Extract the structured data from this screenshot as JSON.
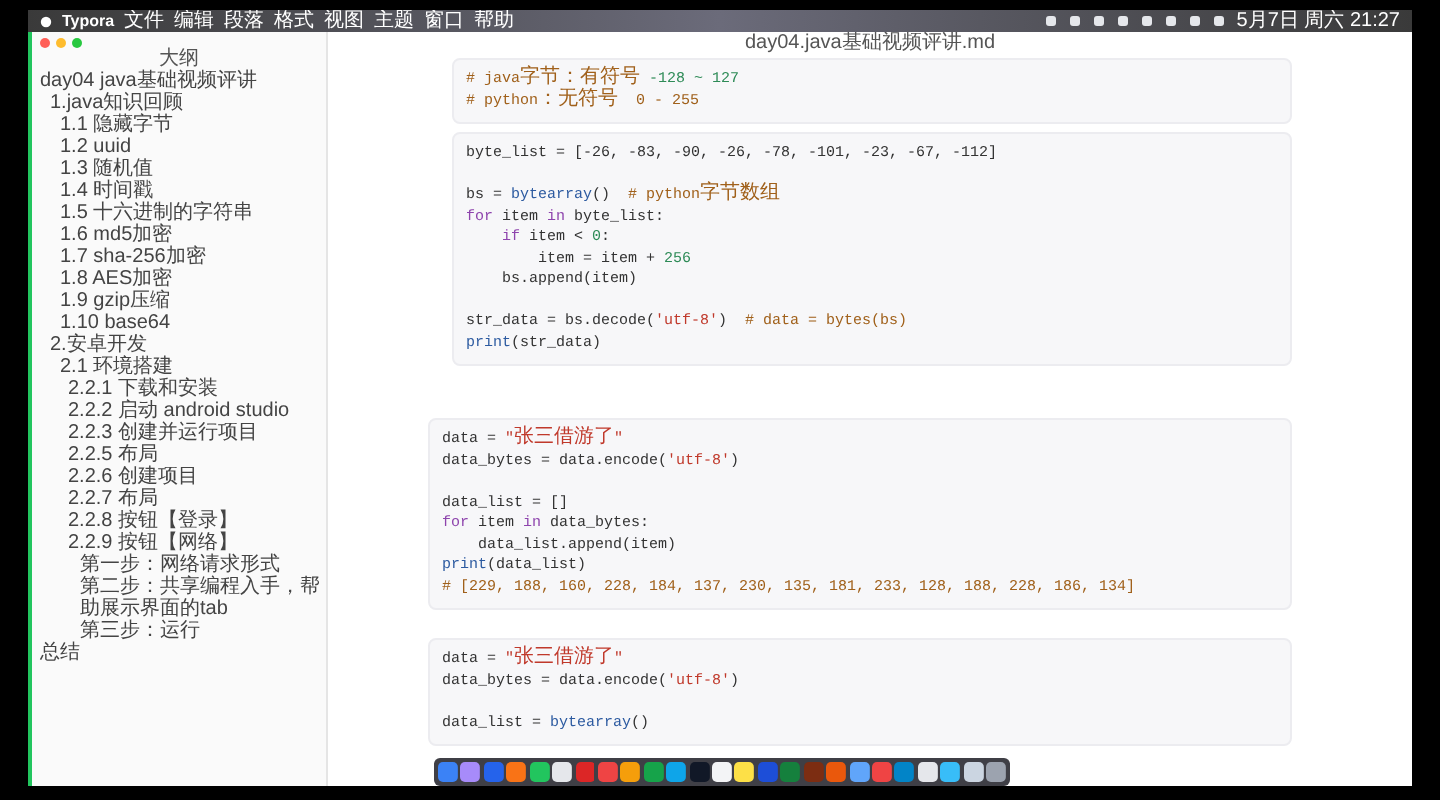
{
  "menu_bar": {
    "app": "Typora",
    "items": [
      "文件",
      "编辑",
      "段落",
      "格式",
      "视图",
      "主题",
      "窗口",
      "帮助"
    ],
    "clock": "5月7日 周六 21:27"
  },
  "window": {
    "title": "day04.java基础视频评讲.md"
  },
  "outline": {
    "heading": "大纲",
    "items": [
      {
        "label": "day04 java基础视频评讲",
        "children": [
          {
            "label": "1.java知识回顾",
            "children": [
              {
                "label": "1.1 隐藏字节"
              },
              {
                "label": "1.2 uuid"
              },
              {
                "label": "1.3 随机值"
              },
              {
                "label": "1.4 时间戳"
              },
              {
                "label": "1.5 十六进制的字符串"
              },
              {
                "label": "1.6 md5加密"
              },
              {
                "label": "1.7 sha-256加密"
              },
              {
                "label": "1.8 AES加密"
              },
              {
                "label": "1.9 gzip压缩"
              },
              {
                "label": "1.10 base64"
              }
            ]
          },
          {
            "label": "2.安卓开发",
            "children": [
              {
                "label": "2.1 环境搭建",
                "children": [
                  {
                    "label": "2.2.1 下载和安装"
                  },
                  {
                    "label": "2.2.2 启动 android studio"
                  },
                  {
                    "label": "2.2.3 创建并运行项目"
                  },
                  {
                    "label": "2.2.5 布局"
                  },
                  {
                    "label": "2.2.6 创建项目"
                  },
                  {
                    "label": "2.2.7 布局"
                  },
                  {
                    "label": "2.2.8 按钮【登录】"
                  },
                  {
                    "label": "2.2.9 按钮【网络】",
                    "children": [
                      {
                        "label": "第一步：网络请求形式"
                      },
                      {
                        "label": "第二步：共享编程入手，帮助展示界面的tab"
                      },
                      {
                        "label": "第三步：运行"
                      }
                    ]
                  }
                ]
              }
            ]
          }
        ]
      },
      {
        "label": "总结"
      }
    ]
  },
  "code_blocks": [
    {
      "lines": [
        {
          "kind": "code",
          "tokens": [
            {
              "kind": "comment",
              "text": "# java字节：有符号 "
            },
            {
              "kind": "number",
              "text": "-128 ~ 127"
            }
          ]
        },
        {
          "kind": "code",
          "tokens": [
            {
              "kind": "comment",
              "text": "# python：无符号  0 - 255"
            }
          ]
        }
      ]
    },
    {
      "lines": [
        {
          "kind": "code",
          "tokens": [
            {
              "kind": "plain",
              "text": "byte_list = [-26, -83, -90, -26, -78, -101, -23, -67, -112]"
            }
          ]
        },
        {
          "kind": "blank"
        },
        {
          "kind": "code",
          "tokens": [
            {
              "kind": "plain",
              "text": "bs ="
            },
            {
              "kind": "builtin",
              "text": " bytearray"
            },
            {
              "kind": "plain",
              "text": "()"
            },
            {
              "kind": "comment",
              "text": "  # python字节数组"
            }
          ]
        },
        {
          "kind": "code",
          "tokens": [
            {
              "kind": "keyword",
              "text": "for"
            },
            {
              "kind": "plain",
              "text": " item "
            },
            {
              "kind": "keyword",
              "text": "in"
            },
            {
              "kind": "plain",
              "text": " byte_list:"
            }
          ]
        },
        {
          "kind": "code",
          "tokens": [
            {
              "kind": "keyword",
              "text": "    if"
            },
            {
              "kind": "plain",
              "text": " item < "
            },
            {
              "kind": "number",
              "text": "0"
            },
            {
              "kind": "plain",
              "text": ":"
            }
          ]
        },
        {
          "kind": "code",
          "tokens": [
            {
              "kind": "plain",
              "text": "        item = item + "
            },
            {
              "kind": "number",
              "text": "256"
            }
          ]
        },
        {
          "kind": "code",
          "tokens": [
            {
              "kind": "plain",
              "text": "    bs.append(item)"
            }
          ]
        },
        {
          "kind": "blank"
        },
        {
          "kind": "code",
          "tokens": [
            {
              "kind": "plain",
              "text": "str_data = bs.decode("
            },
            {
              "kind": "string",
              "text": "'utf-8'"
            },
            {
              "kind": "plain",
              "text": ")"
            },
            {
              "kind": "comment",
              "text": "  # data = bytes(bs)"
            }
          ]
        },
        {
          "kind": "code",
          "tokens": [
            {
              "kind": "builtin",
              "text": "print"
            },
            {
              "kind": "plain",
              "text": "(str_data)"
            }
          ]
        }
      ]
    },
    {
      "lines": [
        {
          "kind": "code",
          "tokens": [
            {
              "kind": "plain",
              "text": "data = "
            },
            {
              "kind": "string",
              "text": "\"张三借游了\""
            }
          ]
        },
        {
          "kind": "code",
          "tokens": [
            {
              "kind": "plain",
              "text": "data_bytes = data.encode("
            },
            {
              "kind": "string",
              "text": "'utf-8'"
            },
            {
              "kind": "plain",
              "text": ")"
            }
          ]
        },
        {
          "kind": "blank"
        },
        {
          "kind": "code",
          "tokens": [
            {
              "kind": "plain",
              "text": "data_list = []"
            }
          ]
        },
        {
          "kind": "code",
          "tokens": [
            {
              "kind": "keyword",
              "text": "for"
            },
            {
              "kind": "plain",
              "text": " item "
            },
            {
              "kind": "keyword",
              "text": "in"
            },
            {
              "kind": "plain",
              "text": " data_bytes:"
            }
          ]
        },
        {
          "kind": "code",
          "tokens": [
            {
              "kind": "plain",
              "text": "    data_list.append(item)"
            }
          ]
        },
        {
          "kind": "code",
          "tokens": [
            {
              "kind": "builtin",
              "text": "print"
            },
            {
              "kind": "plain",
              "text": "(data_list)"
            }
          ]
        },
        {
          "kind": "code",
          "tokens": [
            {
              "kind": "comment",
              "text": "# [229, 188, 160, 228, 184, 137, 230, 135, 181, 233, 128, 188, 228, 186, 134]"
            }
          ]
        }
      ]
    },
    {
      "lines": [
        {
          "kind": "code",
          "tokens": [
            {
              "kind": "plain",
              "text": "data = "
            },
            {
              "kind": "string",
              "text": "\"张三借游了\""
            }
          ]
        },
        {
          "kind": "code",
          "tokens": [
            {
              "kind": "plain",
              "text": "data_bytes = data.encode("
            },
            {
              "kind": "string",
              "text": "'utf-8'"
            },
            {
              "kind": "plain",
              "text": ")"
            }
          ]
        },
        {
          "kind": "blank"
        },
        {
          "kind": "code",
          "tokens": [
            {
              "kind": "plain",
              "text": "data_list = "
            },
            {
              "kind": "builtin",
              "text": "bytearray"
            },
            {
              "kind": "plain",
              "text": "()"
            }
          ]
        }
      ]
    }
  ]
}
